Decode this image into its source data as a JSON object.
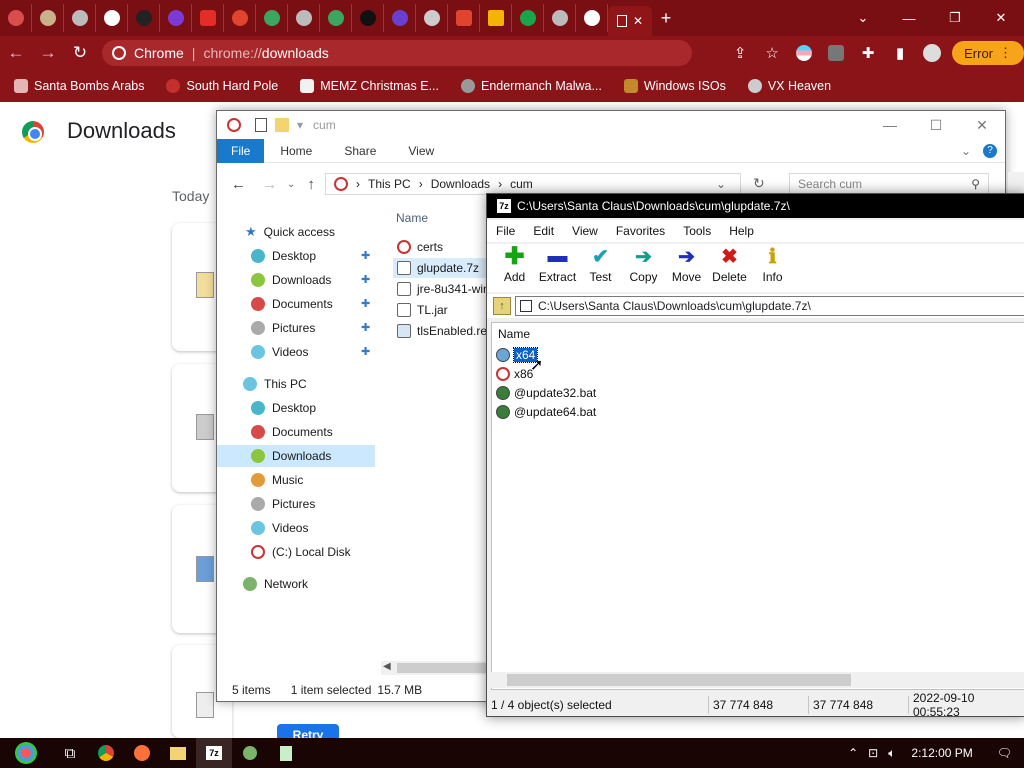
{
  "browser": {
    "omnibox": {
      "site_label": "Chrome",
      "url_prefix": "chrome://",
      "url_path": "downloads"
    },
    "error_label": "Error",
    "bookmarks": [
      "Santa Bombs Arabs",
      "South Hard Pole",
      "MEMZ Christmas E...",
      "Endermanch Malwa...",
      "Windows ISOs",
      "VX Heaven"
    ]
  },
  "downloads_page": {
    "title": "Downloads",
    "section": "Today",
    "retry_label": "Retry"
  },
  "explorer": {
    "title": "cum",
    "ribbon_tabs": [
      "File",
      "Home",
      "Share",
      "View"
    ],
    "breadcrumb": [
      "This PC",
      "Downloads",
      "cum"
    ],
    "search_placeholder": "Search cum",
    "column_name": "Name",
    "nav": {
      "quick_access": "Quick access",
      "quick_items": [
        "Desktop",
        "Downloads",
        "Documents",
        "Pictures",
        "Videos"
      ],
      "this_pc": "This PC",
      "pc_items": [
        "Desktop",
        "Documents",
        "Downloads",
        "Music",
        "Pictures",
        "Videos",
        "(C:) Local Disk"
      ],
      "network": "Network"
    },
    "files": [
      "certs",
      "glupdate.7z",
      "jre-8u341-win",
      "TL.jar",
      "tlsEnabled.reg"
    ],
    "status": {
      "count": "5 items",
      "selected": "1 item selected",
      "size": "15.7 MB"
    }
  },
  "sevenzip": {
    "title": "C:\\Users\\Santa Claus\\Downloads\\cum\\glupdate.7z\\",
    "menu": [
      "File",
      "Edit",
      "View",
      "Favorites",
      "Tools",
      "Help"
    ],
    "tools": [
      "Add",
      "Extract",
      "Test",
      "Copy",
      "Move",
      "Delete",
      "Info"
    ],
    "path": "C:\\Users\\Santa Claus\\Downloads\\cum\\glupdate.7z\\",
    "column_name": "Name",
    "items": [
      "x64",
      "x86",
      "@update32.bat",
      "@update64.bat"
    ],
    "status": {
      "objects": "1 / 4 object(s) selected",
      "size": "37 774 848",
      "packed": "37 774 848",
      "modified": "2022-09-10 00:55:23"
    }
  },
  "taskbar": {
    "clock": "2:12:00 PM"
  }
}
